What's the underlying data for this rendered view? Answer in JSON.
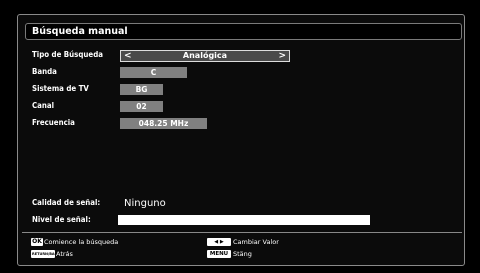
{
  "title": "Búsqueda manual",
  "fields": {
    "search_type": {
      "label": "Tipo de Búsqueda",
      "value": "Analógica",
      "left_arrow": "<",
      "right_arrow": ">"
    },
    "band": {
      "label": "Banda",
      "value": "C"
    },
    "tv_system": {
      "label": "Sistema de TV",
      "value": "BG"
    },
    "channel": {
      "label": "Canal",
      "value": "02"
    },
    "frequency": {
      "label": "Frecuencia",
      "value": "048.25 MHz"
    }
  },
  "signal": {
    "quality_label": "Calidad de señal:",
    "quality_value": "Ninguno",
    "level_label": "Nivel de señal:",
    "level_fraction": 1.0
  },
  "footer": {
    "ok_key": "OK",
    "ok_text": "Comience la búsqueda",
    "back_key": "RETURN/BACK",
    "back_text": "Atrás",
    "lr_key": "◀ ▶",
    "lr_text": "Cambiar Valor",
    "menu_key": "MENU",
    "menu_text": "Stäng"
  },
  "colors": {
    "background": "#000000",
    "value_box": "#808080",
    "selected_box": "#4a4a4a",
    "signal_bar": "#ffffff"
  }
}
